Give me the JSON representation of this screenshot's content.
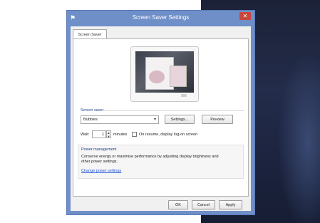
{
  "window": {
    "title": "Screen Saver Settings",
    "close_glyph": "✕"
  },
  "tabs": [
    {
      "label": "Screen Saver"
    }
  ],
  "screen_saver": {
    "group_label": "Screen saver",
    "selected": "Bubbles",
    "settings_label": "Settings...",
    "preview_label": "Preview",
    "wait_label": "Wait:",
    "wait_value": "1",
    "minutes_label": "minutes",
    "on_resume_label": "On resume, display log-on screen",
    "on_resume_checked": false
  },
  "power": {
    "title": "Power management",
    "description": "Conserve energy or maximise performance by adjusting display brightness and other power settings.",
    "link": "Change power settings"
  },
  "buttons": {
    "ok": "OK",
    "cancel": "Cancel",
    "apply": "Apply"
  },
  "colors": {
    "title_bar": "#6f8fc8",
    "close_button": "#c9473a",
    "link": "#2a5bd7",
    "group_label": "#1e3f8a"
  }
}
